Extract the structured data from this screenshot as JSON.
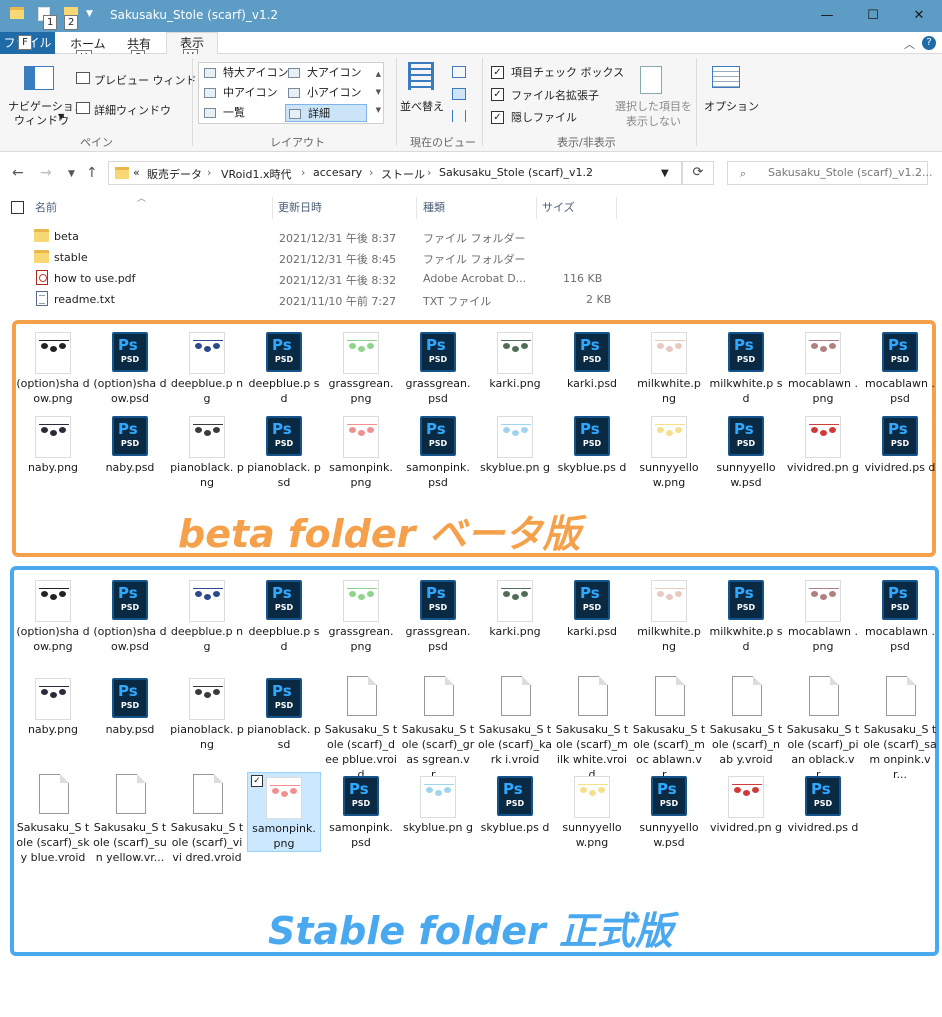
{
  "window": {
    "title": "Sakusaku_Stole (scarf)_v1.2",
    "qat_keytips": [
      "1",
      "2"
    ],
    "controls": {
      "minimize": "—",
      "maximize": "☐",
      "close": "✕"
    }
  },
  "ribbon_tabs": {
    "file": "ファイル",
    "file_key": "F",
    "home": "ホーム",
    "home_key": "H",
    "share": "共有",
    "share_key": "S",
    "view": "表示",
    "view_key": "V"
  },
  "ribbon": {
    "pane": {
      "nav_line1": "ナビゲーション",
      "nav_line2": "ウィンドウ",
      "preview": "プレビュー ウィンドウ",
      "details": "詳細ウィンドウ",
      "label": "ペイン"
    },
    "layout": {
      "items": [
        "特大アイコン",
        "大アイコン",
        "中アイコン",
        "小アイコン",
        "一覧",
        "詳細"
      ],
      "label": "レイアウト"
    },
    "current_view": {
      "sort": "並べ替え",
      "label": "現在のビュー"
    },
    "show_hide": {
      "item_checkbox": "項目チェック ボックス",
      "file_ext": "ファイル名拡張子",
      "hidden": "隠しファイル",
      "hide_selected_line1": "選択した項目を",
      "hide_selected_line2": "表示しない",
      "label": "表示/非表示"
    },
    "options": "オプション"
  },
  "nav": {
    "breadcrumb": [
      "販売データ",
      "VRoid1.x時代",
      "accesary",
      "ストール",
      "Sakusaku_Stole (scarf)_v1.2"
    ],
    "overflow": "«",
    "search_placeholder": "Sakusaku_Stole (scarf)_v1.2..."
  },
  "columns": {
    "name": "名前",
    "date": "更新日時",
    "type": "種類",
    "size": "サイズ"
  },
  "files": [
    {
      "name": "beta",
      "date": "2021/12/31 午後 8:37",
      "type": "ファイル フォルダー",
      "size": "",
      "icon": "folder-icon"
    },
    {
      "name": "stable",
      "date": "2021/12/31 午後 8:45",
      "type": "ファイル フォルダー",
      "size": "",
      "icon": "folder-icon"
    },
    {
      "name": "how to use.pdf",
      "date": "2021/12/31 午後 8:32",
      "type": "Adobe Acrobat D...",
      "size": "116 KB",
      "icon": "pdf-icon"
    },
    {
      "name": "readme.txt",
      "date": "2021/11/10 午前 7:27",
      "type": "TXT ファイル",
      "size": "2 KB",
      "icon": "text-file-icon"
    }
  ],
  "beta_items": [
    {
      "label": "(option)sha dow.png",
      "kind": "png",
      "color": "#222222"
    },
    {
      "label": "(option)sha dow.psd",
      "kind": "psd"
    },
    {
      "label": "deepblue.p ng",
      "kind": "png",
      "color": "#2c4a8a"
    },
    {
      "label": "deepblue.p sd",
      "kind": "psd"
    },
    {
      "label": "grassgrean. png",
      "kind": "png",
      "color": "#8fd48a"
    },
    {
      "label": "grassgrean. psd",
      "kind": "psd"
    },
    {
      "label": "karki.png",
      "kind": "png",
      "color": "#4f6d55"
    },
    {
      "label": "karki.psd",
      "kind": "psd"
    },
    {
      "label": "milkwhite.p ng",
      "kind": "png",
      "color": "#e8c8c0"
    },
    {
      "label": "milkwhite.p sd",
      "kind": "psd"
    },
    {
      "label": "mocablawn .png",
      "kind": "png",
      "color": "#b08080"
    },
    {
      "label": "mocablawn .psd",
      "kind": "psd"
    },
    {
      "label": "naby.png",
      "kind": "png",
      "color": "#2a2a3a"
    },
    {
      "label": "naby.psd",
      "kind": "psd"
    },
    {
      "label": "pianoblack. png",
      "kind": "png",
      "color": "#3a3a3a"
    },
    {
      "label": "pianoblack. psd",
      "kind": "psd"
    },
    {
      "label": "samonpink. png",
      "kind": "png",
      "color": "#f09090"
    },
    {
      "label": "samonpink. psd",
      "kind": "psd"
    },
    {
      "label": "skyblue.pn g",
      "kind": "png",
      "color": "#a0d4ee"
    },
    {
      "label": "skyblue.ps d",
      "kind": "psd"
    },
    {
      "label": "sunnyyello w.png",
      "kind": "png",
      "color": "#f4e08a"
    },
    {
      "label": "sunnyyello w.psd",
      "kind": "psd"
    },
    {
      "label": "vividred.pn g",
      "kind": "png",
      "color": "#d23a3a"
    },
    {
      "label": "vividred.ps d",
      "kind": "psd"
    }
  ],
  "stable_items": [
    {
      "label": "(option)sha dow.png",
      "kind": "png",
      "color": "#222222"
    },
    {
      "label": "(option)sha dow.psd",
      "kind": "psd"
    },
    {
      "label": "deepblue.p ng",
      "kind": "png",
      "color": "#2c4a8a"
    },
    {
      "label": "deepblue.p sd",
      "kind": "psd"
    },
    {
      "label": "grassgrean. png",
      "kind": "png",
      "color": "#8fd48a"
    },
    {
      "label": "grassgrean. psd",
      "kind": "psd"
    },
    {
      "label": "karki.png",
      "kind": "png",
      "color": "#4f6d55"
    },
    {
      "label": "karki.psd",
      "kind": "psd"
    },
    {
      "label": "milkwhite.p ng",
      "kind": "png",
      "color": "#e8c8c0"
    },
    {
      "label": "milkwhite.p sd",
      "kind": "psd"
    },
    {
      "label": "mocablawn .png",
      "kind": "png",
      "color": "#b08080"
    },
    {
      "label": "mocablawn .psd",
      "kind": "psd"
    },
    {
      "label": "naby.png",
      "kind": "png",
      "color": "#2a2a3a"
    },
    {
      "label": "naby.psd",
      "kind": "psd"
    },
    {
      "label": "pianoblack. png",
      "kind": "png",
      "color": "#3a3a3a"
    },
    {
      "label": "pianoblack. psd",
      "kind": "psd"
    },
    {
      "label": "Sakusaku_S tole (scarf)_dee pblue.vroid",
      "kind": "vroid"
    },
    {
      "label": "Sakusaku_S tole (scarf)_gras sgrean.vr...",
      "kind": "vroid"
    },
    {
      "label": "Sakusaku_S tole (scarf)_kark i.vroid",
      "kind": "vroid"
    },
    {
      "label": "Sakusaku_S tole (scarf)_milk white.vroid",
      "kind": "vroid"
    },
    {
      "label": "Sakusaku_S tole (scarf)_moc ablawn.vr...",
      "kind": "vroid"
    },
    {
      "label": "Sakusaku_S tole (scarf)_nab y.vroid",
      "kind": "vroid"
    },
    {
      "label": "Sakusaku_S tole (scarf)_pian oblack.vr...",
      "kind": "vroid"
    },
    {
      "label": "Sakusaku_S tole (scarf)_sam onpink.vr...",
      "kind": "vroid"
    },
    {
      "label": "Sakusaku_S tole (scarf)_sky blue.vroid",
      "kind": "vroid"
    },
    {
      "label": "Sakusaku_S tole (scarf)_sun yellow.vr...",
      "kind": "vroid"
    },
    {
      "label": "Sakusaku_S tole (scarf)_vivi dred.vroid",
      "kind": "vroid"
    },
    {
      "label": "samonpink. png",
      "kind": "png",
      "color": "#f09090",
      "selected": true
    },
    {
      "label": "samonpink. psd",
      "kind": "psd"
    },
    {
      "label": "skyblue.pn g",
      "kind": "png",
      "color": "#a0d4ee"
    },
    {
      "label": "skyblue.ps d",
      "kind": "psd"
    },
    {
      "label": "sunnyyello w.png",
      "kind": "png",
      "color": "#f4e08a"
    },
    {
      "label": "sunnyyello w.psd",
      "kind": "psd"
    },
    {
      "label": "vividred.pn g",
      "kind": "png",
      "color": "#d23a3a"
    },
    {
      "label": "vividred.ps d",
      "kind": "psd"
    }
  ],
  "annotations": {
    "beta": "beta folder ベータ版",
    "stable": "Stable folder 正式版",
    "beta_color": "#f5a04a",
    "stable_color": "#4aa8ee"
  },
  "psd_badge": {
    "big": "Ps",
    "small": "PSD"
  }
}
